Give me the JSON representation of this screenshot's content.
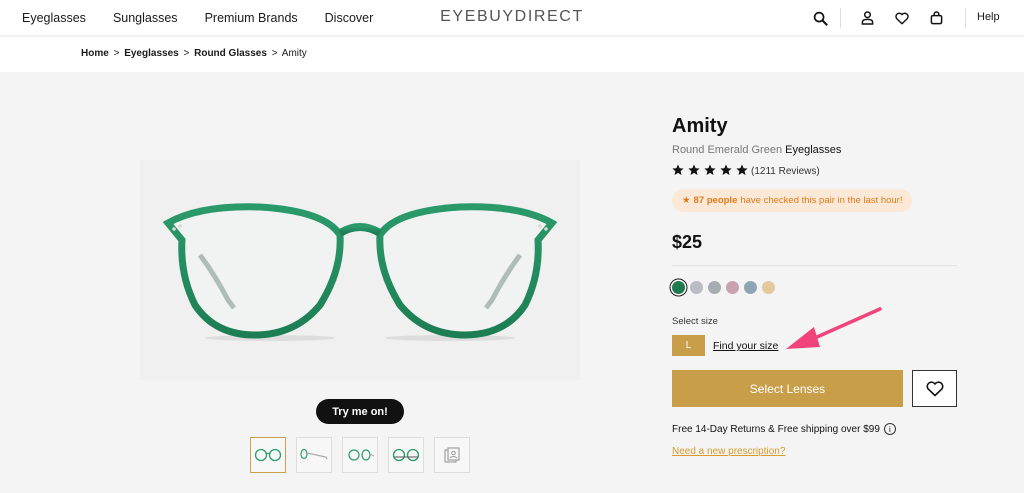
{
  "nav": {
    "links": [
      "Eyeglasses",
      "Sunglasses",
      "Premium Brands",
      "Discover"
    ],
    "logo": "EYEBUYDIRECT",
    "help": "Help"
  },
  "breadcrumb": {
    "items": [
      "Home",
      "Eyeglasses",
      "Round Glasses"
    ],
    "separator": ">",
    "current": "Amity"
  },
  "product": {
    "name": "Amity",
    "subtitle_prefix": "Round Emerald Green",
    "subtitle_type": "Eyeglasses",
    "rating": 5,
    "reviews": "(1211 Reviews)",
    "social_icon": "★",
    "social_count": "87 people",
    "social_text": "have checked this pair in the last hour!",
    "price": "$25",
    "swatches": [
      "#1f7a4f",
      "#b9bcc3",
      "#a8abb2",
      "#c9a2b0",
      "#8ea5b3",
      "#e3c99b"
    ],
    "size_label": "Select size",
    "size_value": "L",
    "find_size": "Find your size",
    "select_lenses": "Select Lenses",
    "shipping": "Free 14-Day Returns & Free shipping over $99",
    "info_icon": "i",
    "prescription_link": "Need a new prescription?",
    "try_on": "Try me on!"
  },
  "colors": {
    "accent": "#c99e49",
    "frame": "#2d9a6a",
    "arrow": "#f0447a"
  }
}
